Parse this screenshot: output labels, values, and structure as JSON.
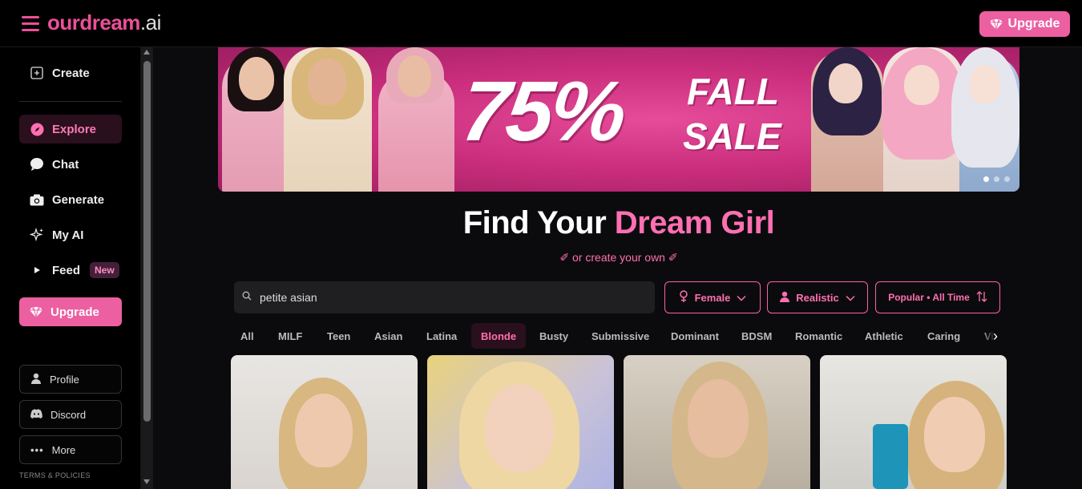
{
  "header": {
    "logo_main": "ourdream",
    "logo_suffix": ".ai",
    "upgrade_label": "Upgrade"
  },
  "sidebar": {
    "create_label": "Create",
    "items": [
      {
        "label": "Explore",
        "icon": "compass-icon",
        "active": true
      },
      {
        "label": "Chat",
        "icon": "chat-bubble-icon",
        "active": false
      },
      {
        "label": "Generate",
        "icon": "camera-icon",
        "active": false
      },
      {
        "label": "My AI",
        "icon": "sparkles-icon",
        "active": false
      },
      {
        "label": "Feed",
        "icon": "play-icon",
        "active": false,
        "badge": "New"
      }
    ],
    "upgrade_label": "Upgrade",
    "profile_label": "Profile",
    "discord_label": "Discord",
    "more_label": "More",
    "terms_label": "TERMS & POLICIES"
  },
  "banner": {
    "percent": "75%",
    "word1": "FALL",
    "word2": "SALE",
    "slide_count": 3,
    "active_slide": 1
  },
  "main": {
    "headline_white": "Find Your",
    "headline_pink": "Dream Girl",
    "subline": "✐ or create your own ✐",
    "search_value": "petite asian",
    "filters": {
      "gender": "Female",
      "style": "Realistic",
      "sort": "Popular • All Time"
    },
    "tags": [
      "All",
      "MILF",
      "Teen",
      "Asian",
      "Latina",
      "Blonde",
      "Busty",
      "Submissive",
      "Dominant",
      "BDSM",
      "Romantic",
      "Athletic",
      "Caring",
      "Virgin"
    ],
    "active_tag": "Blonde"
  },
  "colors": {
    "accent": "#ec5fa1",
    "accent_text": "#ff6fb2",
    "background": "#0b0b0d",
    "sidebar_bg": "#000000"
  }
}
